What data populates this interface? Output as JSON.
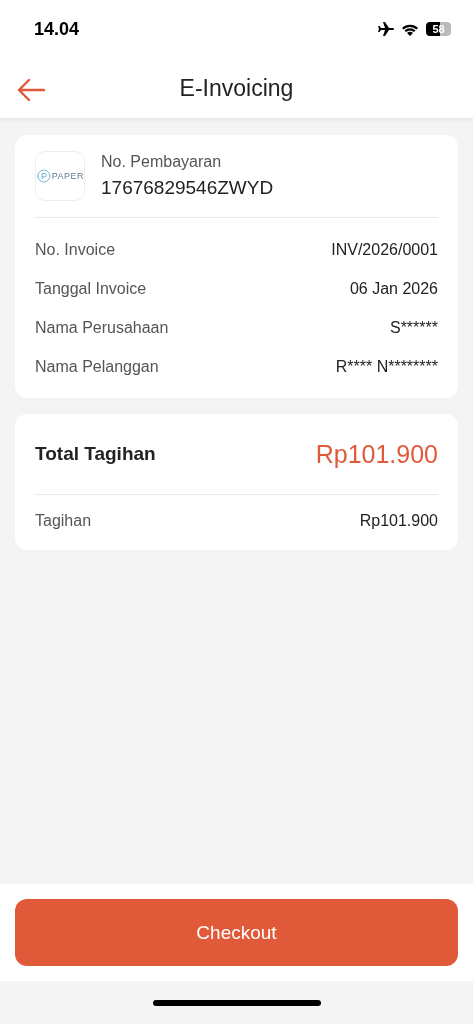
{
  "status_bar": {
    "time": "14.04",
    "battery": "58"
  },
  "header": {
    "title": "E-Invoicing"
  },
  "payment": {
    "logo_text": "PAPER",
    "label": "No. Pembayaran",
    "number": "17676829546ZWYD"
  },
  "details": [
    {
      "label": "No. Invoice",
      "value": "INV/2026/0001"
    },
    {
      "label": "Tanggal Invoice",
      "value": "06 Jan 2026"
    },
    {
      "label": "Nama Perusahaan",
      "value": "S******"
    },
    {
      "label": "Nama Pelanggan",
      "value": "R**** N********"
    }
  ],
  "total": {
    "label": "Total Tagihan",
    "amount": "Rp101.900"
  },
  "breakdown": [
    {
      "label": "Tagihan",
      "value": "Rp101.900"
    }
  ],
  "checkout_button": "Checkout"
}
